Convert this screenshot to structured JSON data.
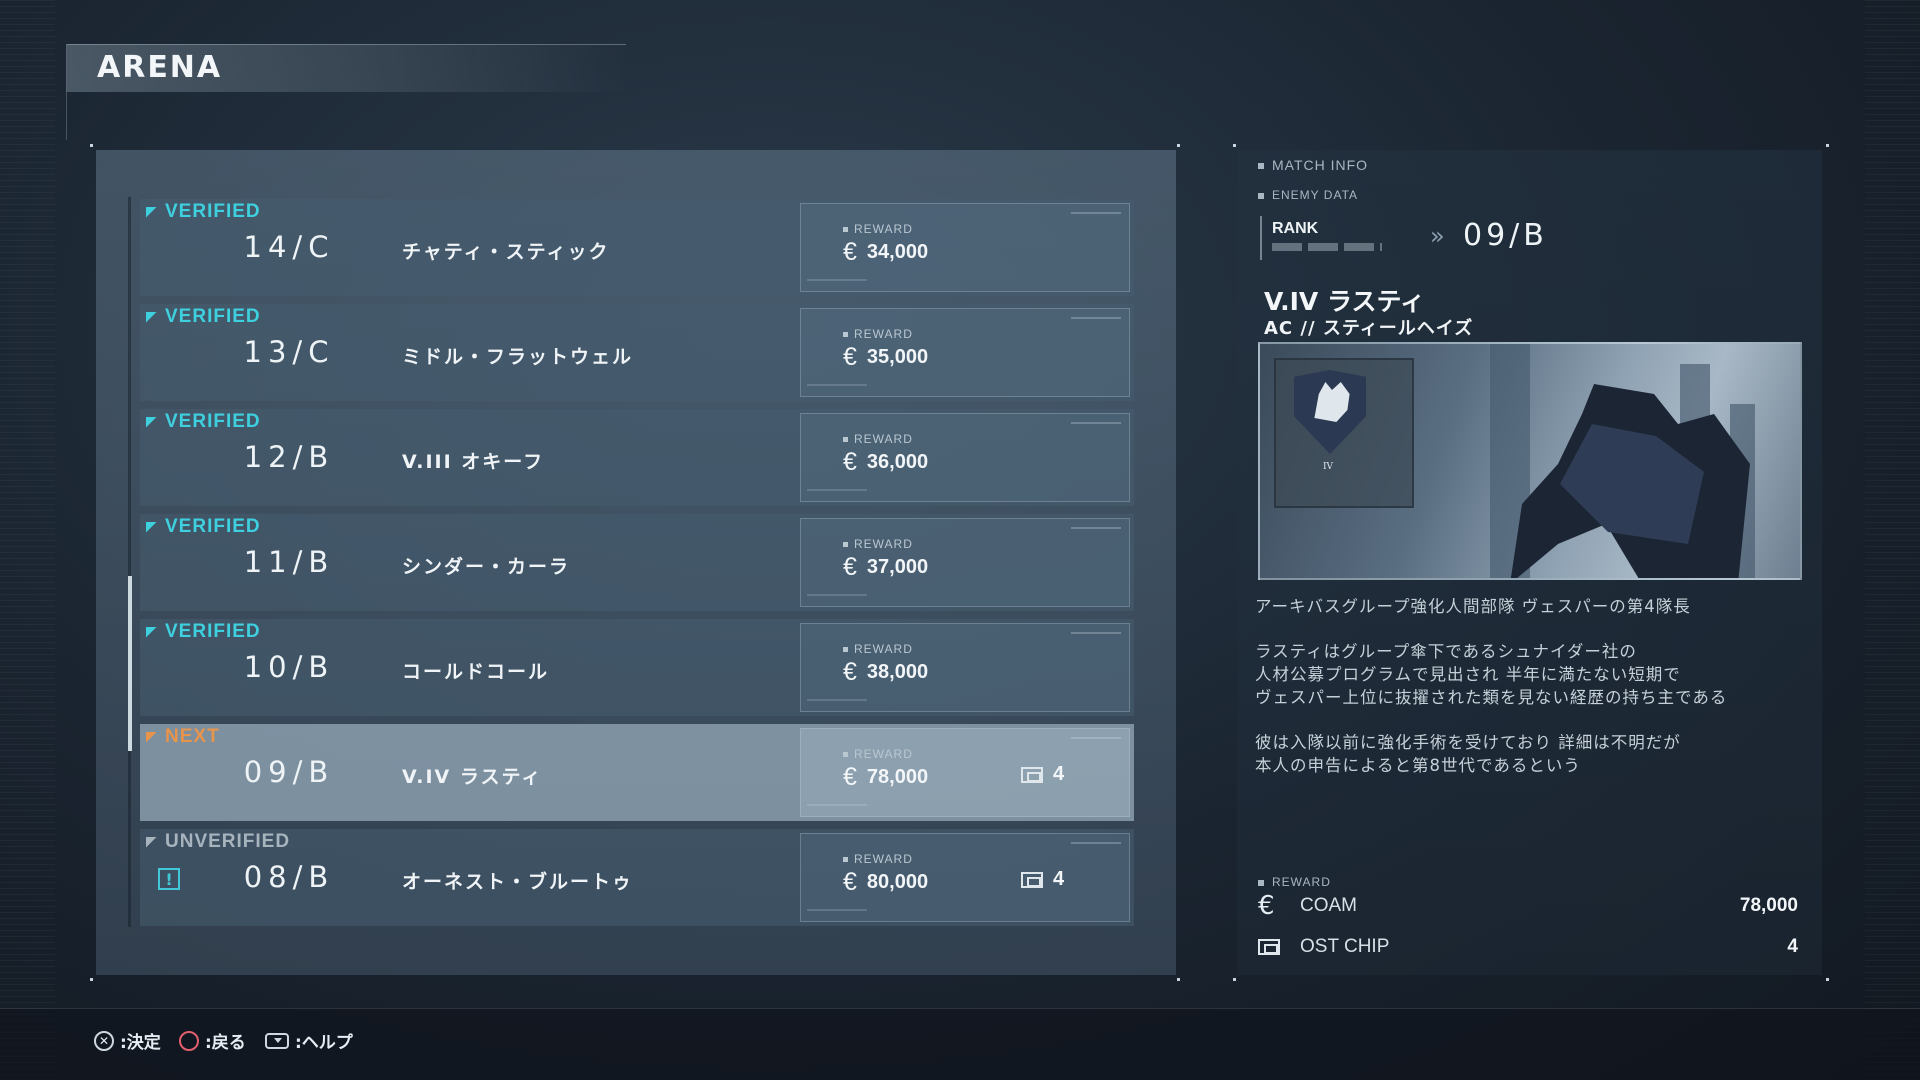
{
  "header": {
    "title": "ARENA"
  },
  "matches": [
    {
      "status": "VERIFIED",
      "rank": "14/C",
      "name": "チャティ・スティック",
      "reward_label": "REWARD",
      "coam": "34,000",
      "chip": ""
    },
    {
      "status": "VERIFIED",
      "rank": "13/C",
      "name": "ミドル・フラットウェル",
      "reward_label": "REWARD",
      "coam": "35,000",
      "chip": ""
    },
    {
      "status": "VERIFIED",
      "rank": "12/B",
      "name": "V.III オキーフ",
      "reward_label": "REWARD",
      "coam": "36,000",
      "chip": ""
    },
    {
      "status": "VERIFIED",
      "rank": "11/B",
      "name": "シンダー・カーラ",
      "reward_label": "REWARD",
      "coam": "37,000",
      "chip": ""
    },
    {
      "status": "VERIFIED",
      "rank": "10/B",
      "name": "コールドコール",
      "reward_label": "REWARD",
      "coam": "38,000",
      "chip": ""
    },
    {
      "status": "NEXT",
      "rank": "09/B",
      "name": "V.IV ラスティ",
      "reward_label": "REWARD",
      "coam": "78,000",
      "chip": "4"
    },
    {
      "status": "UNVERIFIED",
      "rank": "08/B",
      "name": "オーネスト・ブルートゥ",
      "reward_label": "REWARD",
      "coam": "80,000",
      "chip": "4"
    }
  ],
  "status_colors": {
    "VERIFIED": "#3fd0df",
    "NEXT": "#e8944a",
    "UNVERIFIED": "#a7b4be"
  },
  "info": {
    "match_info_label": "MATCH INFO",
    "enemy_data_label": "ENEMY DATA",
    "rank_label": "RANK",
    "rank_value": "09/B",
    "pilot_name": "V.IV ラスティ",
    "ac_name": "AC //  スティールヘイズ",
    "emblem_text": "IV",
    "description": [
      "アーキバスグループ強化人間部隊 ヴェスパーの第4隊長",
      "ラスティはグループ傘下であるシュナイダー社の",
      "人材公募プログラムで見出され 半年に満たない短期で",
      "ヴェスパー上位に抜擢された類を見ない経歴の持ち主である",
      "彼は入隊以前に強化手術を受けており 詳細は不明だが",
      "本人の申告によると第8世代であるという"
    ],
    "reward_label": "REWARD",
    "rewards": [
      {
        "icon": "coam-icon",
        "name": "COAM",
        "value": "78,000"
      },
      {
        "icon": "ost-chip-icon",
        "name": "OST CHIP",
        "value": "4"
      }
    ]
  },
  "footer": {
    "confirm_label": ":決定",
    "back_label": ":戻る",
    "help_label": ":ヘルプ"
  }
}
